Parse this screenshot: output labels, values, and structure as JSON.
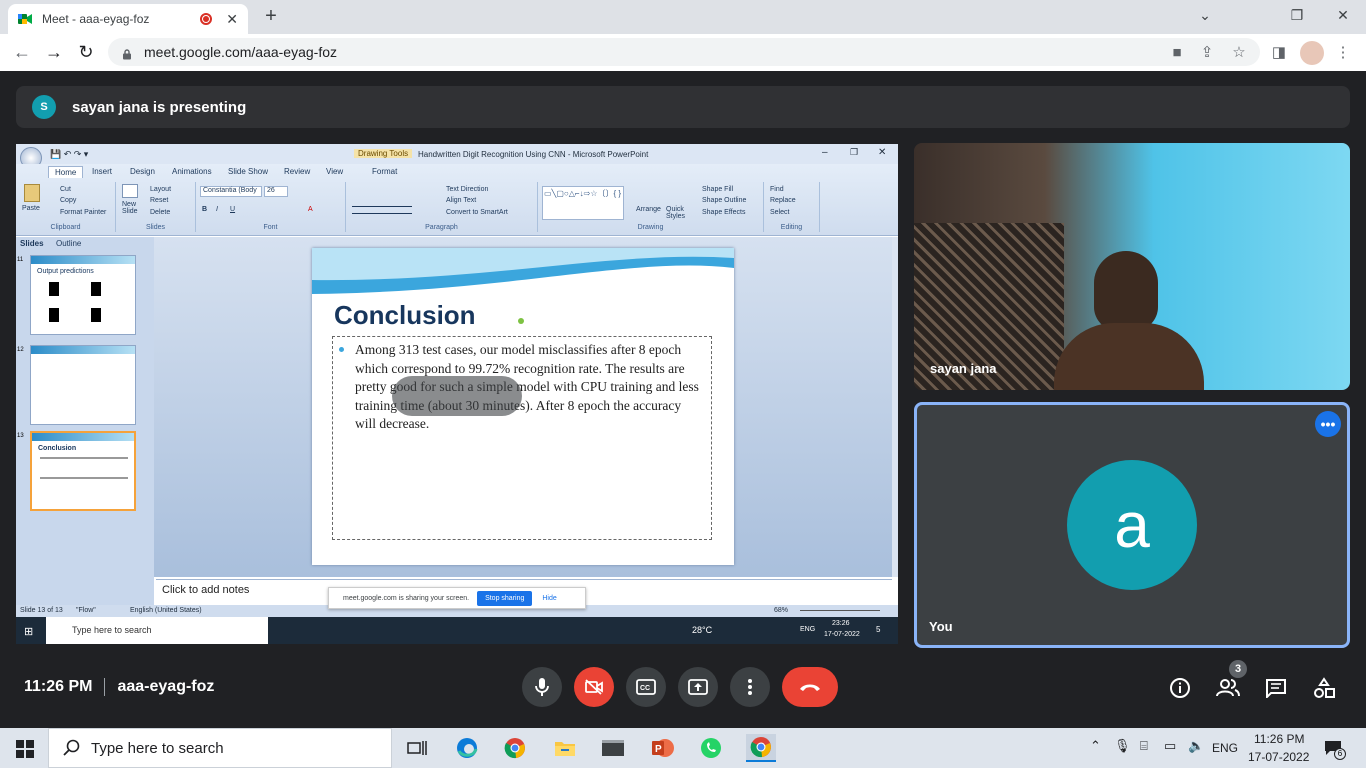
{
  "browser": {
    "tab_title": "Meet - aaa-eyag-foz",
    "tab_close": "✕",
    "new_tab": "+",
    "url": "meet.google.com/aaa-eyag-foz"
  },
  "meet": {
    "presenter_initial": "S",
    "presenting_text": "sayan jana is presenting",
    "tile1_name": "sayan jana",
    "tile2_name": "You",
    "tile2_initial": "a",
    "more_label": "•••",
    "time": "11:26 PM",
    "meeting_code": "aaa-eyag-foz",
    "participants_count": "3"
  },
  "ppt": {
    "window_title": "Handwritten Digit Recognition Using CNN - Microsoft PowerPoint",
    "context_tab": "Drawing Tools",
    "tabs": [
      "Home",
      "Insert",
      "Design",
      "Animations",
      "Slide Show",
      "Review",
      "View",
      "Format"
    ],
    "clipboard": {
      "paste": "Paste",
      "cut": "Cut",
      "copy": "Copy",
      "format_painter": "Format Painter",
      "label": "Clipboard"
    },
    "slides_group": {
      "new_slide": "New Slide",
      "layout": "Layout",
      "reset": "Reset",
      "delete": "Delete",
      "label": "Slides"
    },
    "font": {
      "name": "Constantia (Body",
      "size": "26",
      "label": "Font"
    },
    "paragraph": {
      "text_direction": "Text Direction",
      "align_text": "Align Text",
      "convert": "Convert to SmartArt",
      "label": "Paragraph"
    },
    "drawing": {
      "arrange": "Arrange",
      "quick_styles": "Quick Styles",
      "shape_fill": "Shape Fill",
      "shape_outline": "Shape Outline",
      "shape_effects": "Shape Effects",
      "label": "Drawing"
    },
    "editing": {
      "find": "Find",
      "replace": "Replace",
      "select": "Select",
      "label": "Editing"
    },
    "pane_tabs": {
      "slides": "Slides",
      "outline": "Outline"
    },
    "thumbs": [
      {
        "num": "11",
        "title": "Output predictions"
      },
      {
        "num": "12",
        "title": ""
      },
      {
        "num": "13",
        "title": "Conclusion"
      }
    ],
    "slide_title": "Conclusion",
    "slide_body": "Among  313 test cases, our model misclassifies after 8 epoch which correspond to 99.72% recognition rate. The results are pretty good for such a simple model with CPU training and less training time (about 30 minutes). After 8 epoch the accuracy will decrease.",
    "notes_placeholder": "Click to add notes",
    "status_slide": "Slide 13 of 13",
    "status_theme": "\"Flow\"",
    "status_lang": "English (United States)",
    "zoom": "68%",
    "share_banner": {
      "text": "meet.google.com is sharing your screen.",
      "stop": "Stop sharing",
      "hide": "Hide"
    },
    "inner_taskbar": {
      "search": "Type here to search",
      "weather": "28°C",
      "lang": "ENG",
      "time": "23:26",
      "date": "17-07-2022",
      "notif": "5"
    }
  },
  "taskbar": {
    "search_placeholder": "Type here to search",
    "lang": "ENG",
    "time": "11:26 PM",
    "date": "17-07-2022",
    "notification_count": "6"
  },
  "colors": {
    "meet_bg": "#202124",
    "accent_teal": "#129eaf",
    "end_call": "#ea4335",
    "blue": "#1a73e8",
    "ppt_title": "#17365d"
  }
}
